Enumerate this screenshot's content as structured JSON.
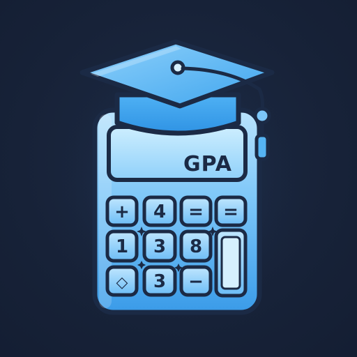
{
  "icon": {
    "screen_label": "GPA",
    "keys": {
      "row1": [
        "+",
        "4",
        "=",
        "="
      ],
      "row2": [
        "1",
        "3",
        "8"
      ],
      "row3": [
        "◇",
        "3",
        "−"
      ]
    }
  },
  "colors": {
    "background": "#18243a",
    "outline": "#1b2a45",
    "body_light": "#9fd6fb",
    "body_mid": "#55b4f3",
    "body_dark": "#2a8fe0",
    "cap_top": "#62baf5",
    "cap_band": "#3ea6ef"
  },
  "icons": [
    "calculator-icon",
    "graduation-cap-icon",
    "tassel-icon"
  ]
}
